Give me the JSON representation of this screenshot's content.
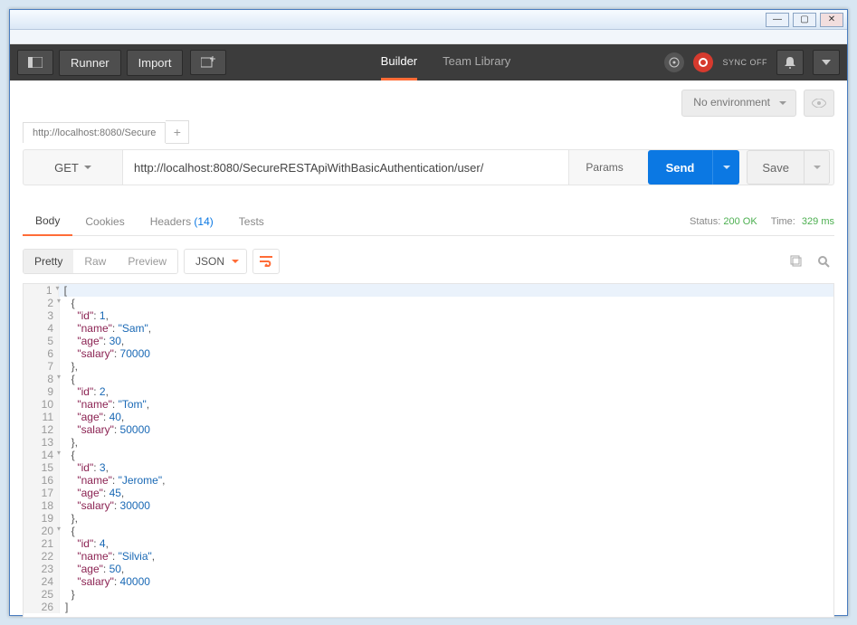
{
  "window": {
    "min": "—",
    "max": "▢",
    "close": "✕"
  },
  "topbar": {
    "runner": "Runner",
    "import": "Import",
    "tabs": {
      "builder": "Builder",
      "team": "Team Library"
    },
    "sync": "SYNC OFF"
  },
  "env": {
    "label": "No environment"
  },
  "request_tab": {
    "title": "http://localhost:8080/Secure",
    "add": "+"
  },
  "request": {
    "method": "GET",
    "url": "http://localhost:8080/SecureRESTApiWithBasicAuthentication/user/",
    "params": "Params",
    "send": "Send",
    "save": "Save"
  },
  "response_tabs": {
    "body": "Body",
    "cookies": "Cookies",
    "headers": "Headers",
    "headers_count": "(14)",
    "tests": "Tests",
    "status_label": "Status:",
    "status_value": "200 OK",
    "time_label": "Time:",
    "time_value": "329 ms"
  },
  "viewer": {
    "pretty": "Pretty",
    "raw": "Raw",
    "preview": "Preview",
    "format": "JSON"
  },
  "json_body": [
    {
      "id": 1,
      "name": "Sam",
      "age": 30,
      "salary": 70000
    },
    {
      "id": 2,
      "name": "Tom",
      "age": 40,
      "salary": 50000
    },
    {
      "id": 3,
      "name": "Jerome",
      "age": 45,
      "salary": 30000
    },
    {
      "id": 4,
      "name": "Silvia",
      "age": 50,
      "salary": 40000
    }
  ]
}
